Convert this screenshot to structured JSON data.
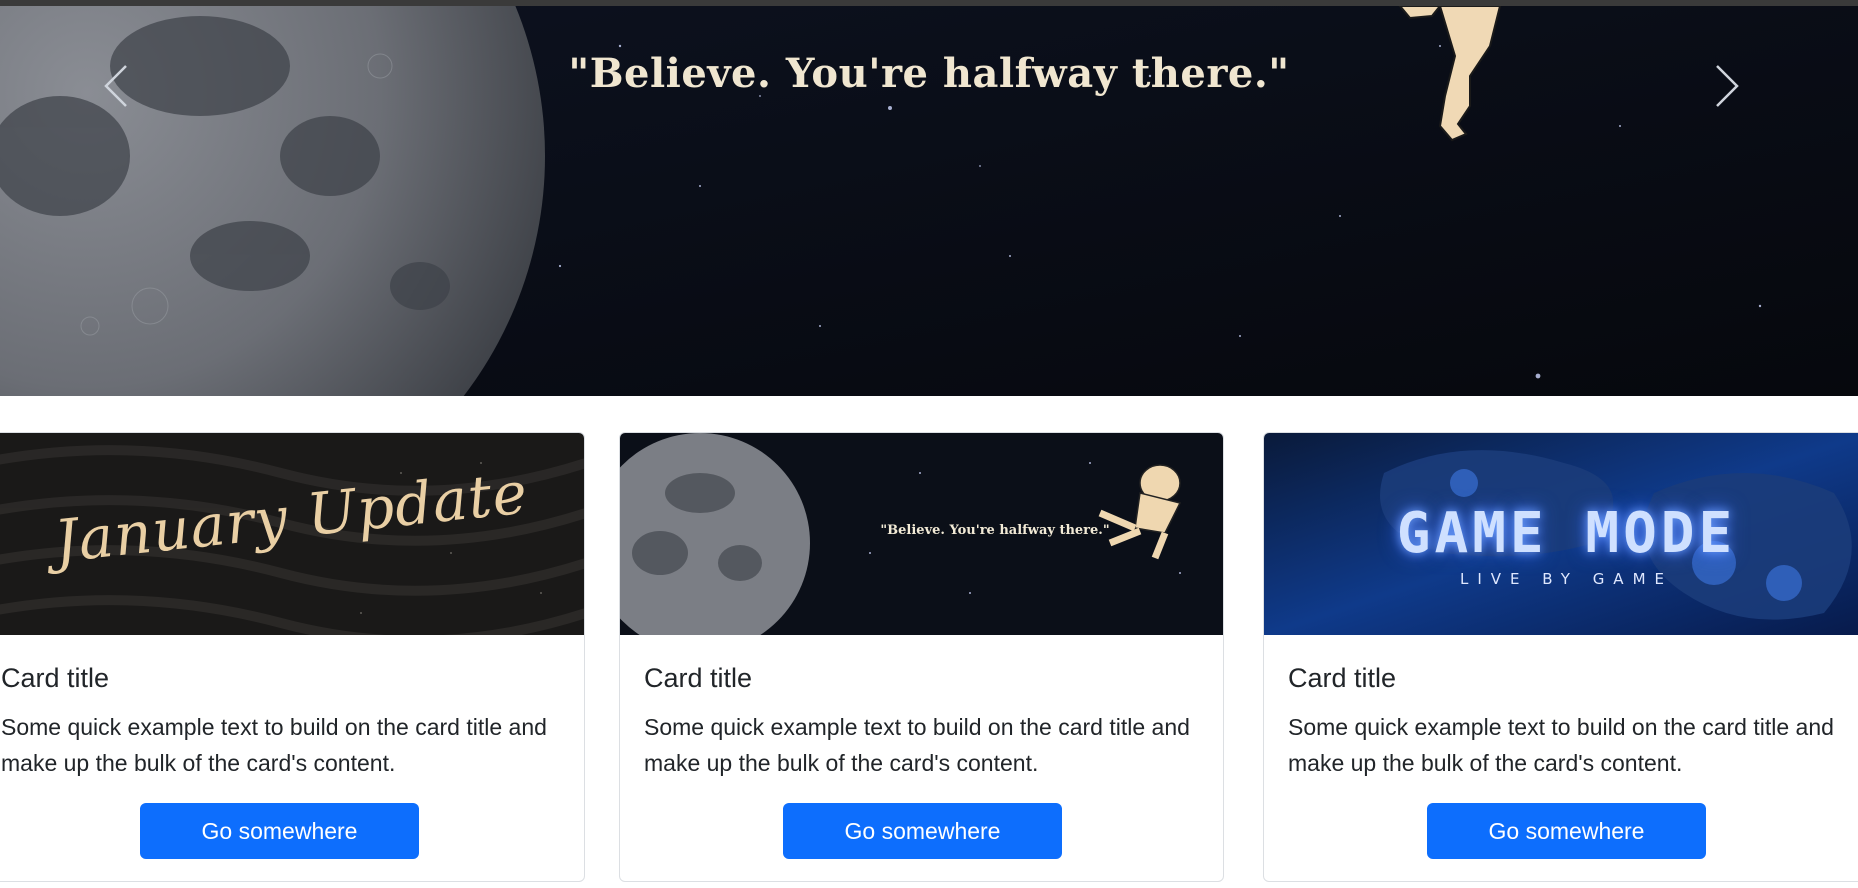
{
  "carousel": {
    "quote": "\"Believe. You're halfway there.\"",
    "prev_icon": "chevron-left-icon",
    "next_icon": "chevron-right-icon"
  },
  "cards": [
    {
      "image_text": "January Update",
      "title": "Card title",
      "text": "Some quick example text to build on the card title and make up the bulk of the card's content.",
      "button": "Go somewhere"
    },
    {
      "image_text": "\"Believe. You're halfway there.\"",
      "title": "Card title",
      "text": "Some quick example text to build on the card title and make up the bulk of the card's content.",
      "button": "Go somewhere"
    },
    {
      "image_text": "GAME MODE",
      "image_subtext": "LIVE BY GAME",
      "title": "Card title",
      "text": "Some quick example text to build on the card title and make up the bulk of the card's content.",
      "button": "Go somewhere"
    }
  ],
  "colors": {
    "primary": "#0d6efd",
    "text": "#212529",
    "space": "#0a0e16"
  }
}
